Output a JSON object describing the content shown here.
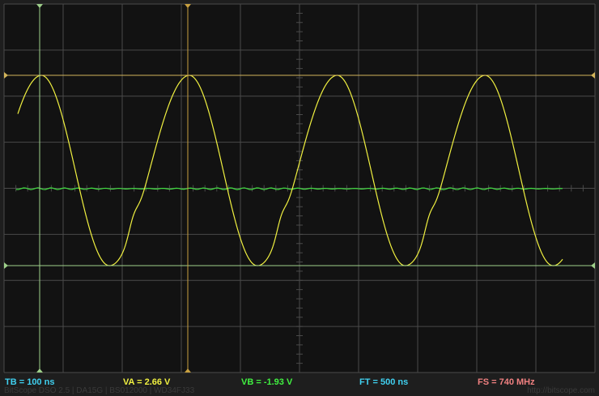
{
  "status": {
    "tb": "TB = 100 ns",
    "va": "VA = 2.66 V",
    "vb": "VB = -1.93 V",
    "ft": "FT = 500 ns",
    "fs": "FS = 740 MHz"
  },
  "footer": {
    "left": "BitScope DSO 2.5 | DA15G | BS012000 | WD34FJ33",
    "right": "http://bitscope.com"
  },
  "colors": {
    "background": "#121212",
    "grid": "#4a4a4a",
    "ch_a": "#f0f040",
    "ch_b": "#40e040",
    "cursor_time_a": "#9ed08a",
    "cursor_time_b": "#c8a040",
    "cursor_volt": "#d2b45a",
    "tb": "#40d0f0",
    "va": "#f0f040",
    "vb": "#40f040",
    "ft": "#40d0f0",
    "fs": "#f08080"
  }
}
